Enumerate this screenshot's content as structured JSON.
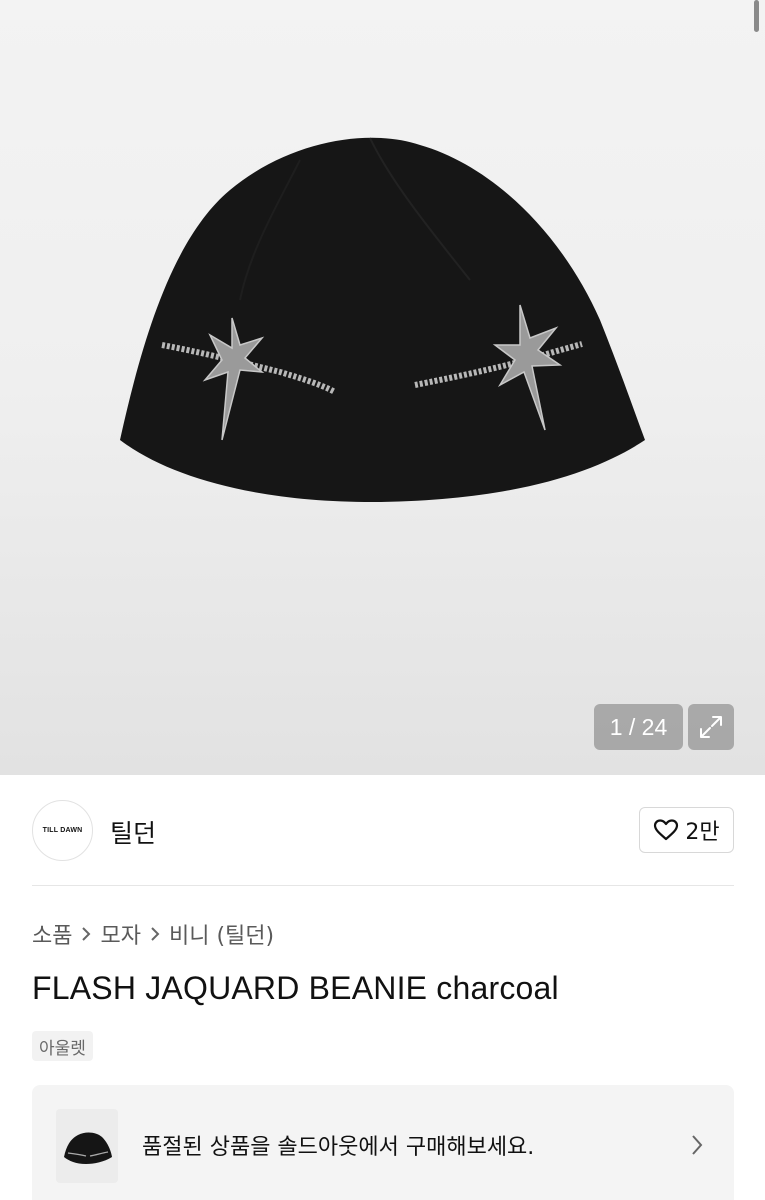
{
  "gallery": {
    "current_index": "1",
    "total": "24",
    "counter_text": "1 / 24"
  },
  "brand": {
    "logo_text": "TILL DAWN",
    "name": "틸던"
  },
  "like": {
    "count": "2만"
  },
  "breadcrumb": {
    "items": [
      "소품",
      "모자",
      "비니 (틸던)"
    ]
  },
  "product": {
    "title": "FLASH JAQUARD BEANIE charcoal",
    "tag": "아울렛"
  },
  "soldout_banner": {
    "text": "품절된 상품을 솔드아웃에서 구매해보세요."
  },
  "colors": {
    "beanie": "#161616",
    "jacquard": "#b8b8b8",
    "overlay": "#8c8c8c"
  }
}
